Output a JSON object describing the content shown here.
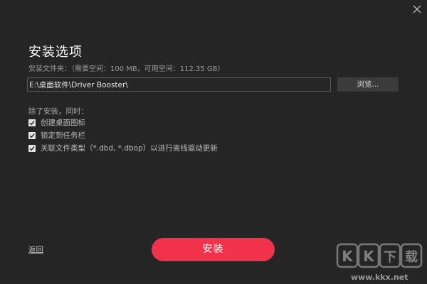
{
  "window": {
    "close_icon": "close-icon"
  },
  "title": "安装选项",
  "folder": {
    "label": "安装文件夹：（需要空间：100 MB，可用空间：112.35 GB）",
    "path_value": "E:\\桌面软件\\Driver Booster\\",
    "browse_label": "浏览..."
  },
  "options": {
    "heading": "除了安装，同时：",
    "items": [
      {
        "label": "创建桌面图标",
        "checked": true
      },
      {
        "label": "锁定到任务栏",
        "checked": true
      },
      {
        "label": "关联文件类型（*.dbd, *.dbop）以进行离线驱动更新",
        "checked": true
      }
    ]
  },
  "footer": {
    "back_label": "返回",
    "install_label": "安装"
  },
  "watermark": {
    "logo_text": "KK下载",
    "url": "www.kkx.net"
  },
  "colors": {
    "background": "#252525",
    "accent": "#f2324a",
    "button_gray": "#3b3b3b"
  }
}
